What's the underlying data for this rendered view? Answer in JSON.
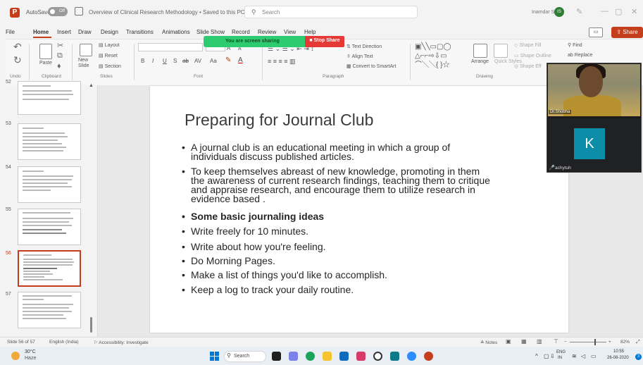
{
  "titlebar": {
    "autosave_label": "AutoSave",
    "autosave_state": "Off",
    "doc_title": "Overview of Clinical Research Methodology • Saved to this PC ⌄",
    "search_placeholder": "Search",
    "user_name": "Inamdar Singh",
    "user_initials": "IS"
  },
  "menu": {
    "tabs": [
      "File",
      "Home",
      "Insert",
      "Draw",
      "Design",
      "Transitions",
      "Animations",
      "Slide Show",
      "Record",
      "Review",
      "View",
      "Help"
    ],
    "active_tab": "Home",
    "share_label": "Share"
  },
  "screen_share": {
    "banner_text": "You are screen sharing",
    "stop_label": "Stop Share",
    "banner_color": "#2ecc71",
    "stop_color": "#e53935"
  },
  "ribbon": {
    "undo_group": "Undo",
    "clipboard": {
      "paste": "Paste",
      "group": "Clipboard"
    },
    "slides": {
      "new_slide": "New\nSlide",
      "layout": "Layout",
      "reset": "Reset",
      "section": "Section",
      "group": "Slides"
    },
    "font": {
      "group": "Font",
      "buttons": [
        "B",
        "I",
        "U",
        "S",
        "ab",
        "AV",
        "Aa",
        "A"
      ]
    },
    "paragraph": {
      "group": "Paragraph",
      "text_direction": "Text Direction",
      "align_text": "Align Text",
      "convert_smartart": "Convert to SmartArt"
    },
    "drawing": {
      "group": "Drawing",
      "arrange": "Arrange",
      "quick_styles": "Quick Styles",
      "shape_fill": "Shape Fill",
      "shape_outline": "Shape Outline",
      "shape_effects": "Shape Eff"
    },
    "editing": {
      "find": "Find",
      "replace": "Replace"
    }
  },
  "thumbnails": [
    {
      "num": "52",
      "selected": false
    },
    {
      "num": "53",
      "selected": false
    },
    {
      "num": "54",
      "selected": false
    },
    {
      "num": "55",
      "selected": false
    },
    {
      "num": "56",
      "selected": true
    },
    {
      "num": "57",
      "selected": false
    }
  ],
  "slide": {
    "title": "Preparing for Journal Club",
    "bullets": [
      {
        "lines": [
          "A journal club is an educational meeting in which a group of",
          "individuals discuss published articles."
        ],
        "bold": false
      },
      {
        "lines": [
          " To keep themselves abreast of new knowledge, promoting in them",
          "the awareness of current research findings, teaching them to critique",
          "and appraise research, and encourage them to utilize research in",
          "evidence based ."
        ],
        "bold": false
      },
      {
        "lines": [
          "Some basic journaling ideas"
        ],
        "bold": true
      },
      {
        "lines": [
          "Write freely for 10 minutes."
        ],
        "bold": false
      },
      {
        "lines": [
          "Write about how you're feeling."
        ],
        "bold": false
      },
      {
        "lines": [
          "Do Morning Pages."
        ],
        "bold": false
      },
      {
        "lines": [
          "Make a list of things you'd like to accomplish."
        ],
        "bold": false
      },
      {
        "lines": [
          "Keep a log to track your daily routine."
        ],
        "bold": false
      }
    ]
  },
  "video": {
    "presenter_name": "Dr.Shobha",
    "participant_initial": "K",
    "participant_name": "achytuh"
  },
  "statusbar": {
    "slide_count": "Slide 56 of 57",
    "language": "English (India)",
    "accessibility": "Accessibility: Investigate",
    "notes": "Notes",
    "zoom": "82%"
  },
  "taskbar": {
    "temperature": "30°C",
    "weather": "Haze",
    "search_label": "Search",
    "lang_line1": "ENG",
    "lang_line2": "IN",
    "time": "10:55",
    "date": "26-08-2020",
    "notification_count": "3"
  }
}
